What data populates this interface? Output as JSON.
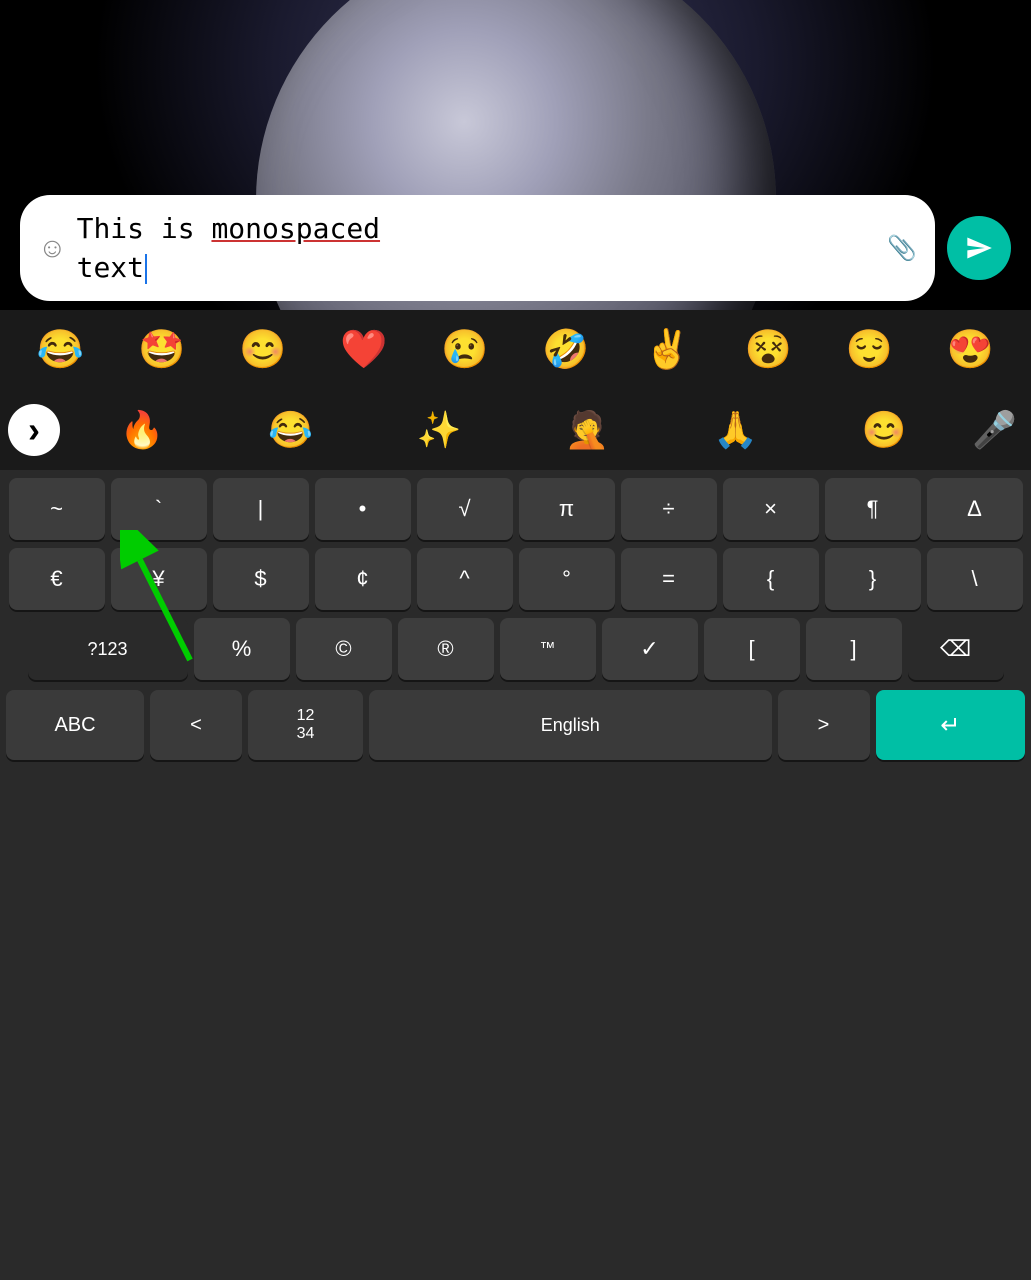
{
  "background": {
    "color": "#000000"
  },
  "input": {
    "text_part1": "This is ",
    "text_underlined": "monospaced",
    "text_part2": "text",
    "emoji_icon": "☺",
    "placeholder": ""
  },
  "send_button": {
    "label": "Send"
  },
  "emoji_row": {
    "emojis": [
      "😂",
      "🤩",
      "😊",
      "❤️",
      "😢",
      "🤣",
      "✌️",
      "😵",
      "😌",
      "😍"
    ]
  },
  "emoji_suggestions": {
    "nav_label": ">",
    "emojis": [
      "🔥",
      "😂",
      "✨",
      "🤦",
      "🙏",
      "😊"
    ],
    "mic_label": "🎤"
  },
  "keyboard": {
    "row1": [
      "~",
      "`",
      "|",
      "•",
      "√",
      "π",
      "÷",
      "×",
      "¶",
      "Δ"
    ],
    "row2": [
      "€",
      "¥",
      "$",
      "¢",
      "^",
      "°",
      "=",
      "{",
      "}",
      "\\"
    ],
    "row3_special": [
      "?123",
      "%",
      "©",
      "®",
      "™",
      "✓",
      "[",
      "]",
      "⌫"
    ],
    "bottom": {
      "abc": "ABC",
      "left_arrow": "<",
      "num_grid": "12\n34",
      "space": "English",
      "right_arrow": ">",
      "enter": "↵"
    }
  }
}
